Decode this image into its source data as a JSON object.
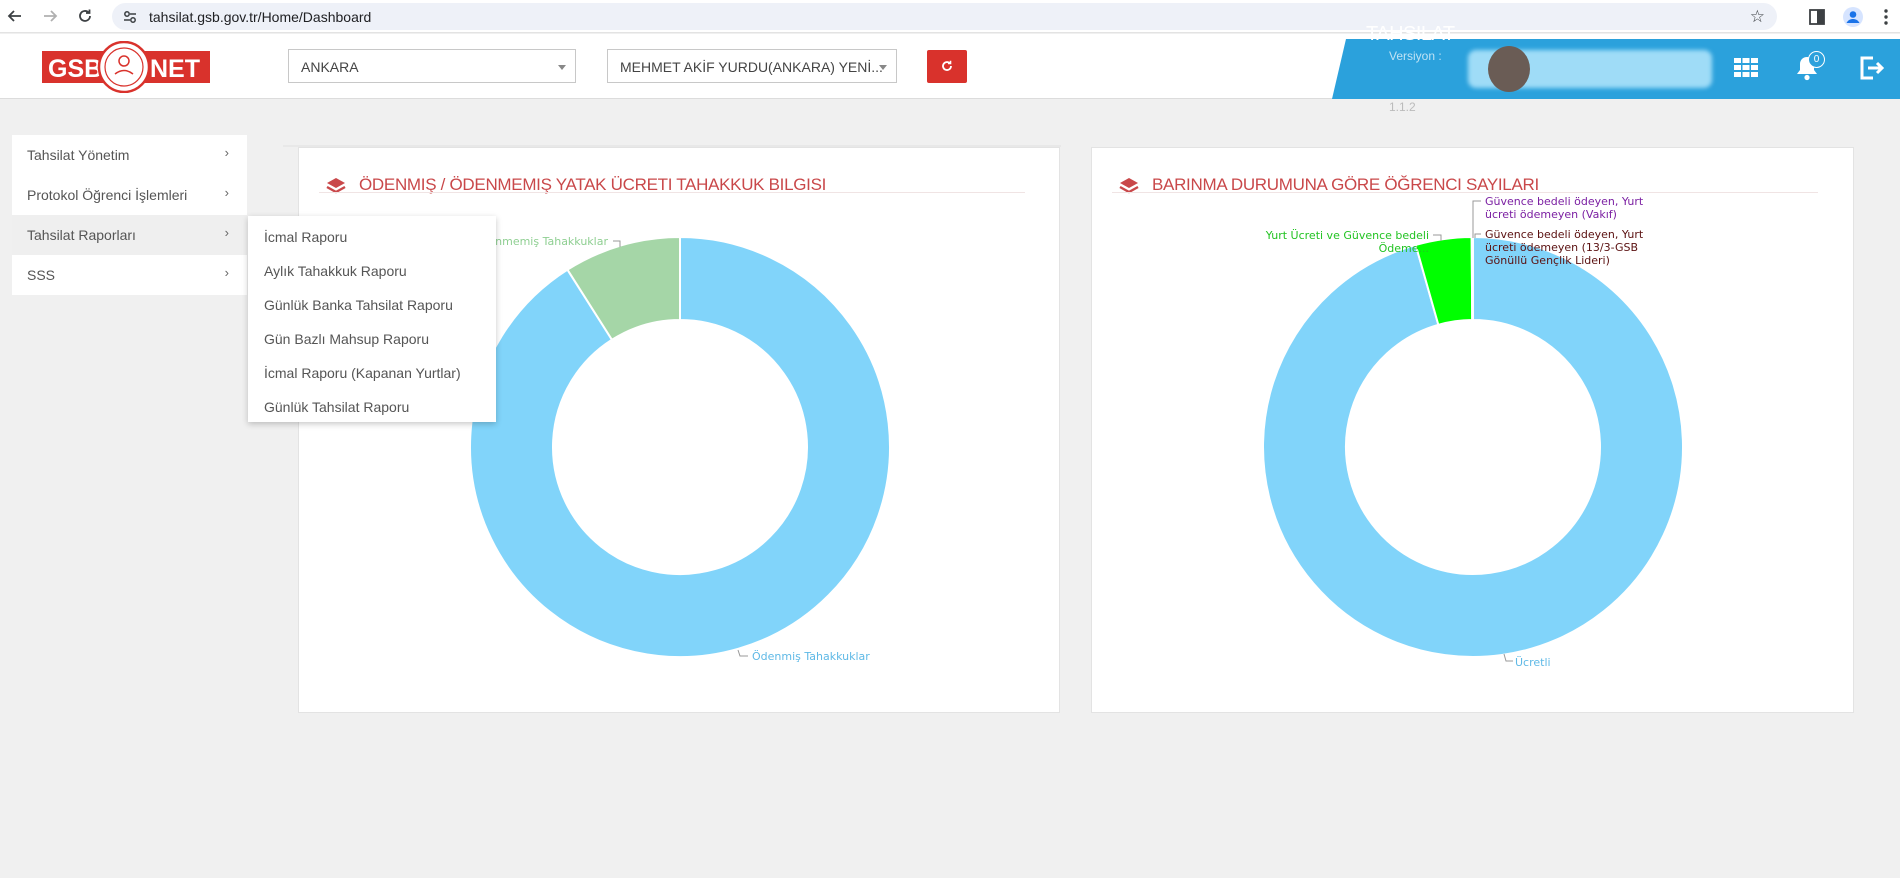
{
  "browser": {
    "url": "tahsilat.gsb.gov.tr/Home/Dashboard"
  },
  "header": {
    "logo_text_left": "GSB",
    "logo_text_right": "NET",
    "province_select": "ANKARA",
    "dorm_select": "MEHMET AKİF YURDU(ANKARA) YENİ...",
    "app_title": "TAHSILAT",
    "version_label": "Versiyon :",
    "version_value": "1.1.2",
    "notification_count": "0",
    "colors": {
      "accent": "#2ba1dc",
      "refresh": "#d9322c"
    }
  },
  "sidebar": {
    "items": [
      {
        "label": "Tahsilat Yönetim"
      },
      {
        "label": "Protokol Öğrenci İşlemleri"
      },
      {
        "label": "Tahsilat Raporları"
      },
      {
        "label": "SSS"
      }
    ]
  },
  "submenu": {
    "items": [
      "İcmal Raporu",
      "Aylık Tahakkuk Raporu",
      "Günlük Banka Tahsilat Raporu",
      "Gün Bazlı Mahsup Raporu",
      "İcmal Raporu (Kapanan Yurtlar)",
      "Günlük Tahsilat Raporu"
    ]
  },
  "cards": {
    "left_title": "ÖDENMIŞ / ÖDENMEMIŞ YATAK ÜCRETI TAHAKKUK BILGISI",
    "right_title": "BARINMA DURUMUNA GÖRE ÖĞRENCI SAYILARI"
  },
  "chart_data": [
    {
      "type": "pie",
      "style": "donut",
      "labels": [
        "Ödenmiş Tahakkuklar",
        "Ödenmemiş Tahakkuklar"
      ],
      "visible_labels": [
        "Ödenmiş Tahakkuklar",
        "...nmemiş Tahakkuklar"
      ],
      "values": [
        91,
        9
      ],
      "colors": [
        "#81d4fa",
        "#a5d6a7"
      ],
      "label_colors": [
        "#5fb9e6",
        "#8fcf92"
      ]
    },
    {
      "type": "pie",
      "style": "donut",
      "labels": [
        "Ücretli",
        "Yurt Ücreti ve Güvence bedeli Ödemeyen",
        "Güvence bedeli ödeyen, Yurt ücreti ödemeyen (Vakıf)",
        "Güvence bedeli ödeyen, Yurt ücreti ödemeyen (13/3-GSB Gönüllü Gençlik Lideri)"
      ],
      "visible_labels": [
        [
          "Ücretli"
        ],
        [
          "Yurt Ücreti ve Güvence bedeli",
          "Ödeme..."
        ],
        [
          "Güvence bedeli ödeyen, Yurt",
          "ücreti ödemeyen (Vakıf)"
        ],
        [
          "Güvence bedeli ödeyen, Yurt",
          "ücreti ödemeyen (13/3-GSB",
          "Gönüllü Gençlik Lideri)"
        ]
      ],
      "values": [
        95.6,
        4.3,
        0.05,
        0.05
      ],
      "colors": [
        "#81d4fa",
        "#00ff00",
        "#7b1fa2",
        "#8b1a1a"
      ],
      "label_colors": [
        "#5fb9e6",
        "#22c322",
        "#7b1fa2",
        "#5a1010"
      ]
    }
  ]
}
